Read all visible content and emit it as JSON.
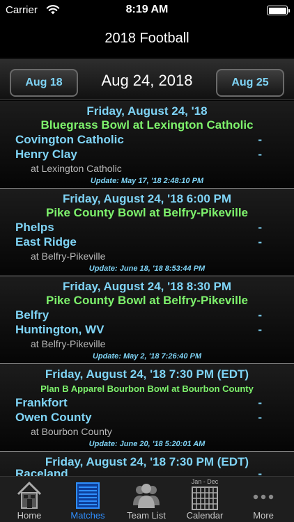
{
  "status_bar": {
    "carrier": "Carrier",
    "time": "8:19 AM"
  },
  "nav": {
    "title": "2018 Football"
  },
  "date_nav": {
    "prev_label": "Aug 18",
    "current": "Aug 24, 2018",
    "next_label": "Aug 25"
  },
  "matches": [
    {
      "date": "Friday, August 24, '18",
      "bowl": "Bluegrass Bowl at Lexington Catholic",
      "team1": "Covington Catholic",
      "score1": "-",
      "team2": "Henry Clay",
      "score2": "-",
      "venue": "at Lexington Catholic",
      "update": "Update: May 17, '18 2:48:10 PM"
    },
    {
      "date": "Friday, August 24, '18 6:00 PM",
      "bowl": "Pike County Bowl at Belfry-Pikeville",
      "team1": "Phelps",
      "score1": "-",
      "team2": "East Ridge",
      "score2": "-",
      "venue": "at Belfry-Pikeville",
      "update": "Update: June 18, '18 8:53:44 PM"
    },
    {
      "date": "Friday, August 24, '18 8:30 PM",
      "bowl": "Pike County Bowl at Belfry-Pikeville",
      "team1": "Belfry",
      "score1": "-",
      "team2": "Huntington, WV",
      "score2": "-",
      "venue": "at Belfry-Pikeville",
      "update": "Update: May 2, '18 7:26:40 PM"
    },
    {
      "date": "Friday, August 24, '18 7:30 PM (EDT)",
      "bowl": "Plan B Apparel Bourbon Bowl at Bourbon County",
      "team1": "Frankfort",
      "score1": "-",
      "team2": "Owen County",
      "score2": "-",
      "venue": "at Bourbon County",
      "update": "Update: June 20, '18 5:20:01 AM"
    },
    {
      "date": "Friday, August 24, '18 7:30 PM (EDT)",
      "bowl": "",
      "team1": "Raceland",
      "score1": "-",
      "team2": "",
      "score2": "",
      "venue": "",
      "update": ""
    }
  ],
  "tabs": [
    {
      "label": "Home",
      "icon": "house-icon",
      "active": false
    },
    {
      "label": "Matches",
      "icon": "matches-list-icon",
      "active": true
    },
    {
      "label": "Team List",
      "icon": "team-people-icon",
      "active": false
    },
    {
      "label": "Calendar",
      "icon": "calendar-grid-icon",
      "active": false,
      "caption": "Jan - Dec"
    },
    {
      "label": "More",
      "icon": "more-dots-icon",
      "active": false
    }
  ],
  "colors": {
    "accent_blue": "#7fd4f6",
    "bowl_green": "#7ef26c",
    "tab_active": "#2f8fff"
  }
}
